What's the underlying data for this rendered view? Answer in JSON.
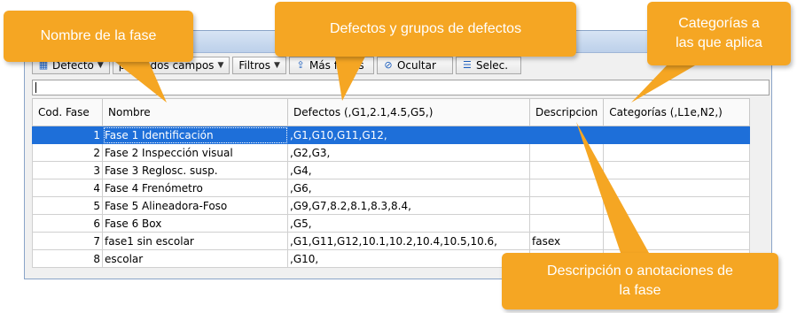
{
  "toolbar": {
    "defecto_label": "Defecto",
    "search_all_label": "por todos campos",
    "filtros_label": "Filtros",
    "mas_filtros_label": "Más filtros",
    "ocultar_label": "Ocultar",
    "selec_label": "Selec."
  },
  "table": {
    "headers": [
      "Cod. Fase",
      "Nombre",
      "Defectos (,G1,2.1,4.5,G5,)",
      "Descripcion",
      "Categorías (,L1e,N2,)"
    ],
    "rows": [
      {
        "cod": "1",
        "nombre": "Fase 1 Identificación",
        "defectos": ",G1,G10,G11,G12,",
        "descripcion": "",
        "categorias": ""
      },
      {
        "cod": "2",
        "nombre": "Fase 2 Inspección visual",
        "defectos": ",G2,G3,",
        "descripcion": "",
        "categorias": ""
      },
      {
        "cod": "3",
        "nombre": "Fase 3 Reglosc. susp.",
        "defectos": ",G4,",
        "descripcion": "",
        "categorias": ""
      },
      {
        "cod": "4",
        "nombre": "Fase 4 Frenómetro",
        "defectos": ",G6,",
        "descripcion": "",
        "categorias": ""
      },
      {
        "cod": "5",
        "nombre": "Fase 5 Alineadora-Foso",
        "defectos": ",G9,G7,8.2,8.1,8.3,8.4,",
        "descripcion": "",
        "categorias": ""
      },
      {
        "cod": "6",
        "nombre": "Fase 6 Box",
        "defectos": ",G5,",
        "descripcion": "",
        "categorias": ""
      },
      {
        "cod": "7",
        "nombre": "fase1 sin escolar",
        "defectos": ",G1,G11,G12,10.1,10.2,10.4,10.5,10.6,",
        "descripcion": "fasex",
        "categorias": ""
      },
      {
        "cod": "8",
        "nombre": "escolar",
        "defectos": ",G10,",
        "descripcion": "",
        "categorias": ""
      }
    ]
  },
  "callouts": {
    "nombre": "Nombre de la fase",
    "defectos": "Defectos y grupos de defectos",
    "categorias_line1": "Categorías a",
    "categorias_line2": "las que aplica",
    "descripcion_line1": "Descripción o anotaciones de",
    "descripcion_line2": "la fase"
  },
  "colors": {
    "callout": "#f5a623",
    "selection": "#1e6fd9"
  },
  "icons": [
    "grid-icon",
    "filter-add-icon",
    "hide-icon",
    "select-icon",
    "chevron-down-icon"
  ]
}
